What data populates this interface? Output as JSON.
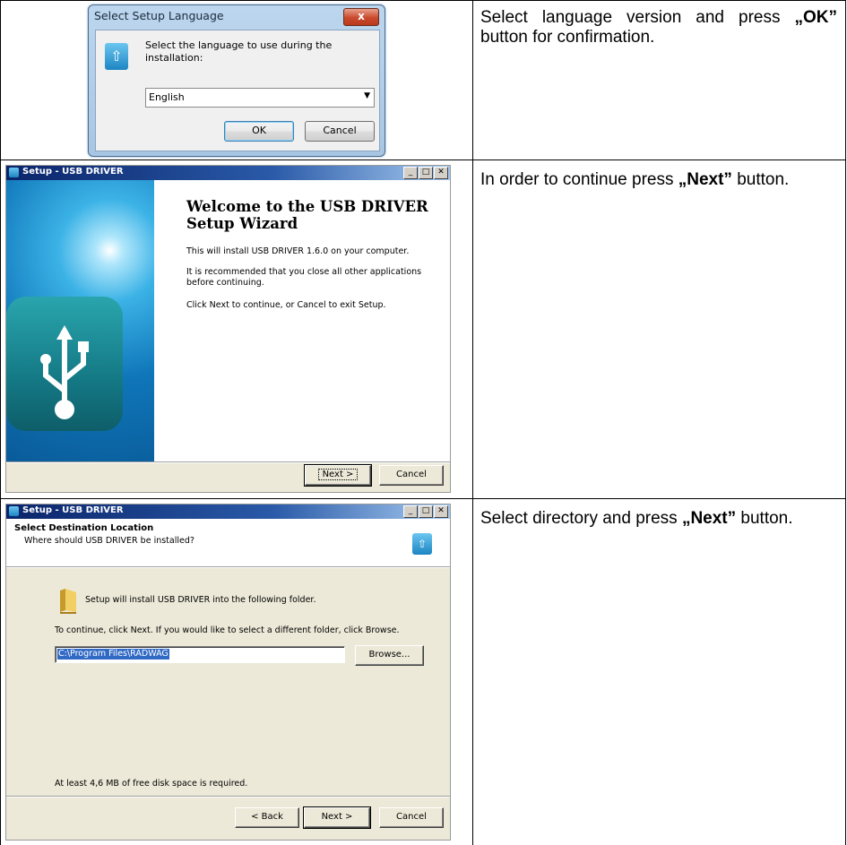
{
  "row1": {
    "dialog": {
      "title": "Select Setup Language",
      "close_label": "x",
      "prompt": "Select the language to use during the installation:",
      "language_selected": "English",
      "ok_label": "OK",
      "cancel_label": "Cancel"
    },
    "instruction_pre": "Select language version and press ",
    "instruction_bold": "„OK”",
    "instruction_post": " button for confirmation."
  },
  "row2": {
    "wizard": {
      "title": "Setup - USB DRIVER",
      "heading": "Welcome to the USB DRIVER Setup Wizard",
      "p1": "This will install USB DRIVER 1.6.0 on your computer.",
      "p2": "It is recommended that you close all other applications before continuing.",
      "p3": "Click Next to continue, or Cancel to exit Setup.",
      "next_label": "Next >",
      "cancel_label": "Cancel"
    },
    "instruction_pre": "In order to continue press ",
    "instruction_bold": "„Next”",
    "instruction_post": " button."
  },
  "row3": {
    "wizard": {
      "title": "Setup - USB DRIVER",
      "page_title": "Select Destination Location",
      "page_subtitle": "Where should USB DRIVER be installed?",
      "folder_text": "Setup will install USB DRIVER into the following folder.",
      "continue_text": "To continue, click Next. If you would like to select a different folder, click Browse.",
      "path_value": "C:\\Program Files\\RADWAG",
      "browse_label": "Browse...",
      "disk_space_text": "At least 4,6 MB of free disk space is required.",
      "back_label": "< Back",
      "next_label": "Next >",
      "cancel_label": "Cancel"
    },
    "instruction_pre": "Select directory and press ",
    "instruction_bold": "„Next”",
    "instruction_post": " button."
  },
  "colors": {
    "win7_frame": "#a8c6e3",
    "classic_titlebar": "#0a246a",
    "wizard_face": "#ece9d8",
    "selection": "#316ac5"
  },
  "icons": [
    "usb-installer-icon",
    "close-icon",
    "dropdown-arrow-icon",
    "minimize-icon",
    "maximize-icon",
    "folder-icon",
    "usb-symbol-icon"
  ]
}
